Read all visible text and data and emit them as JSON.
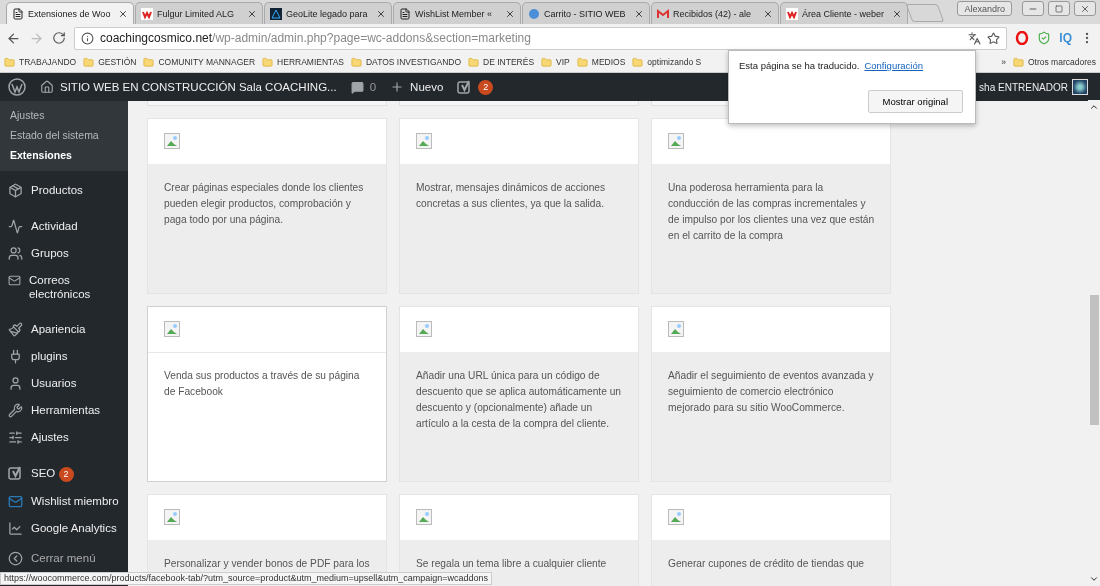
{
  "browser": {
    "tabs": [
      {
        "title": "Extensiones de Woo",
        "selected": true
      },
      {
        "title": "Fulgur Limited ALG",
        "selected": false
      },
      {
        "title": "GeoLite legado para",
        "selected": false
      },
      {
        "title": "WishList Member «",
        "selected": false
      },
      {
        "title": "Carrito - SITIO WEB",
        "selected": false
      },
      {
        "title": "Recibidos (42) - ale",
        "selected": false
      },
      {
        "title": "Área Cliente - weber",
        "selected": false
      }
    ],
    "profile": "Alexandro",
    "address": {
      "host": "coachingcosmico.net",
      "path": "/wp-admin/admin.php?page=wc-addons&section=marketing"
    },
    "extension_labels": [
      "IQ"
    ],
    "bookmarks": [
      "TRABAJANDO",
      "GESTIÓN",
      "COMUNITY MANNAGER",
      "HERRAMIENTAS",
      "DATOS INVESTIGANDO",
      "DE INTERÉS",
      "VIP",
      "MEDIOS",
      "optimizando S"
    ],
    "bookmarks_more": "»",
    "other_bookmarks": "Otros marcadores",
    "status_url": "https://woocommerce.com/products/facebook-tab/?utm_source=product&utm_medium=upsell&utm_campaign=wcaddons"
  },
  "translate_popup": {
    "message": "Esta página se ha traducido.",
    "link": "Configuración",
    "button": "Mostrar original"
  },
  "admin_bar": {
    "site_title": "SITIO WEB EN CONSTRUCCIÓN Sala COACHING...",
    "comments": "0",
    "new": "Nuevo",
    "seo_badge": "2",
    "user": "sha ENTRENADOR"
  },
  "sidebar": {
    "submenu": [
      {
        "label": "Ajustes",
        "selected": false
      },
      {
        "label": "Estado del sistema",
        "selected": false
      },
      {
        "label": "Extensiones",
        "selected": true
      }
    ],
    "groups": [
      [
        {
          "label": "Productos"
        }
      ],
      [
        {
          "label": "Actividad"
        },
        {
          "label": "Grupos"
        },
        {
          "label": "Correos electrónicos"
        }
      ],
      [
        {
          "label": "Apariencia"
        },
        {
          "label": "plugins"
        },
        {
          "label": "Usuarios"
        },
        {
          "label": "Herramientas"
        },
        {
          "label": "Ajustes"
        }
      ],
      [
        {
          "label": "SEO",
          "badge": "2"
        },
        {
          "label": "Wishlist miembro"
        },
        {
          "label": "Google Analytics"
        }
      ],
      [
        {
          "label": "Cerrar menú"
        }
      ]
    ]
  },
  "cards": [
    {
      "description": "Crear páginas especiales donde los clientes pueden elegir productos, comprobación y paga todo por una página.",
      "highlighted": false
    },
    {
      "description": "Mostrar, mensajes dinámicos de acciones concretas a sus clientes, ya que la salida.",
      "highlighted": false
    },
    {
      "description": "Una poderosa herramienta para la conducción de las compras incrementales y de impulso por los clientes una vez que están en el carrito de la compra",
      "highlighted": false
    },
    {
      "description": "Venda sus productos a través de su página de Facebook",
      "highlighted": true
    },
    {
      "description": "Añadir una URL única para un código de descuento que se aplica automáticamente un descuento y (opcionalmente) añade un artículo a la cesta de la compra del cliente.",
      "highlighted": false
    },
    {
      "description": "Añadir el seguimiento de eventos avanzada y seguimiento de comercio electrónico mejorado para su sitio WooCommerce.",
      "highlighted": false
    },
    {
      "description": "Personalizar y vender bonos de PDF para los",
      "highlighted": false
    },
    {
      "description": "Se regala un tema libre a cualquier cliente",
      "highlighted": false
    },
    {
      "description": "Generar cupones de crédito de tiendas que",
      "highlighted": false
    }
  ]
}
